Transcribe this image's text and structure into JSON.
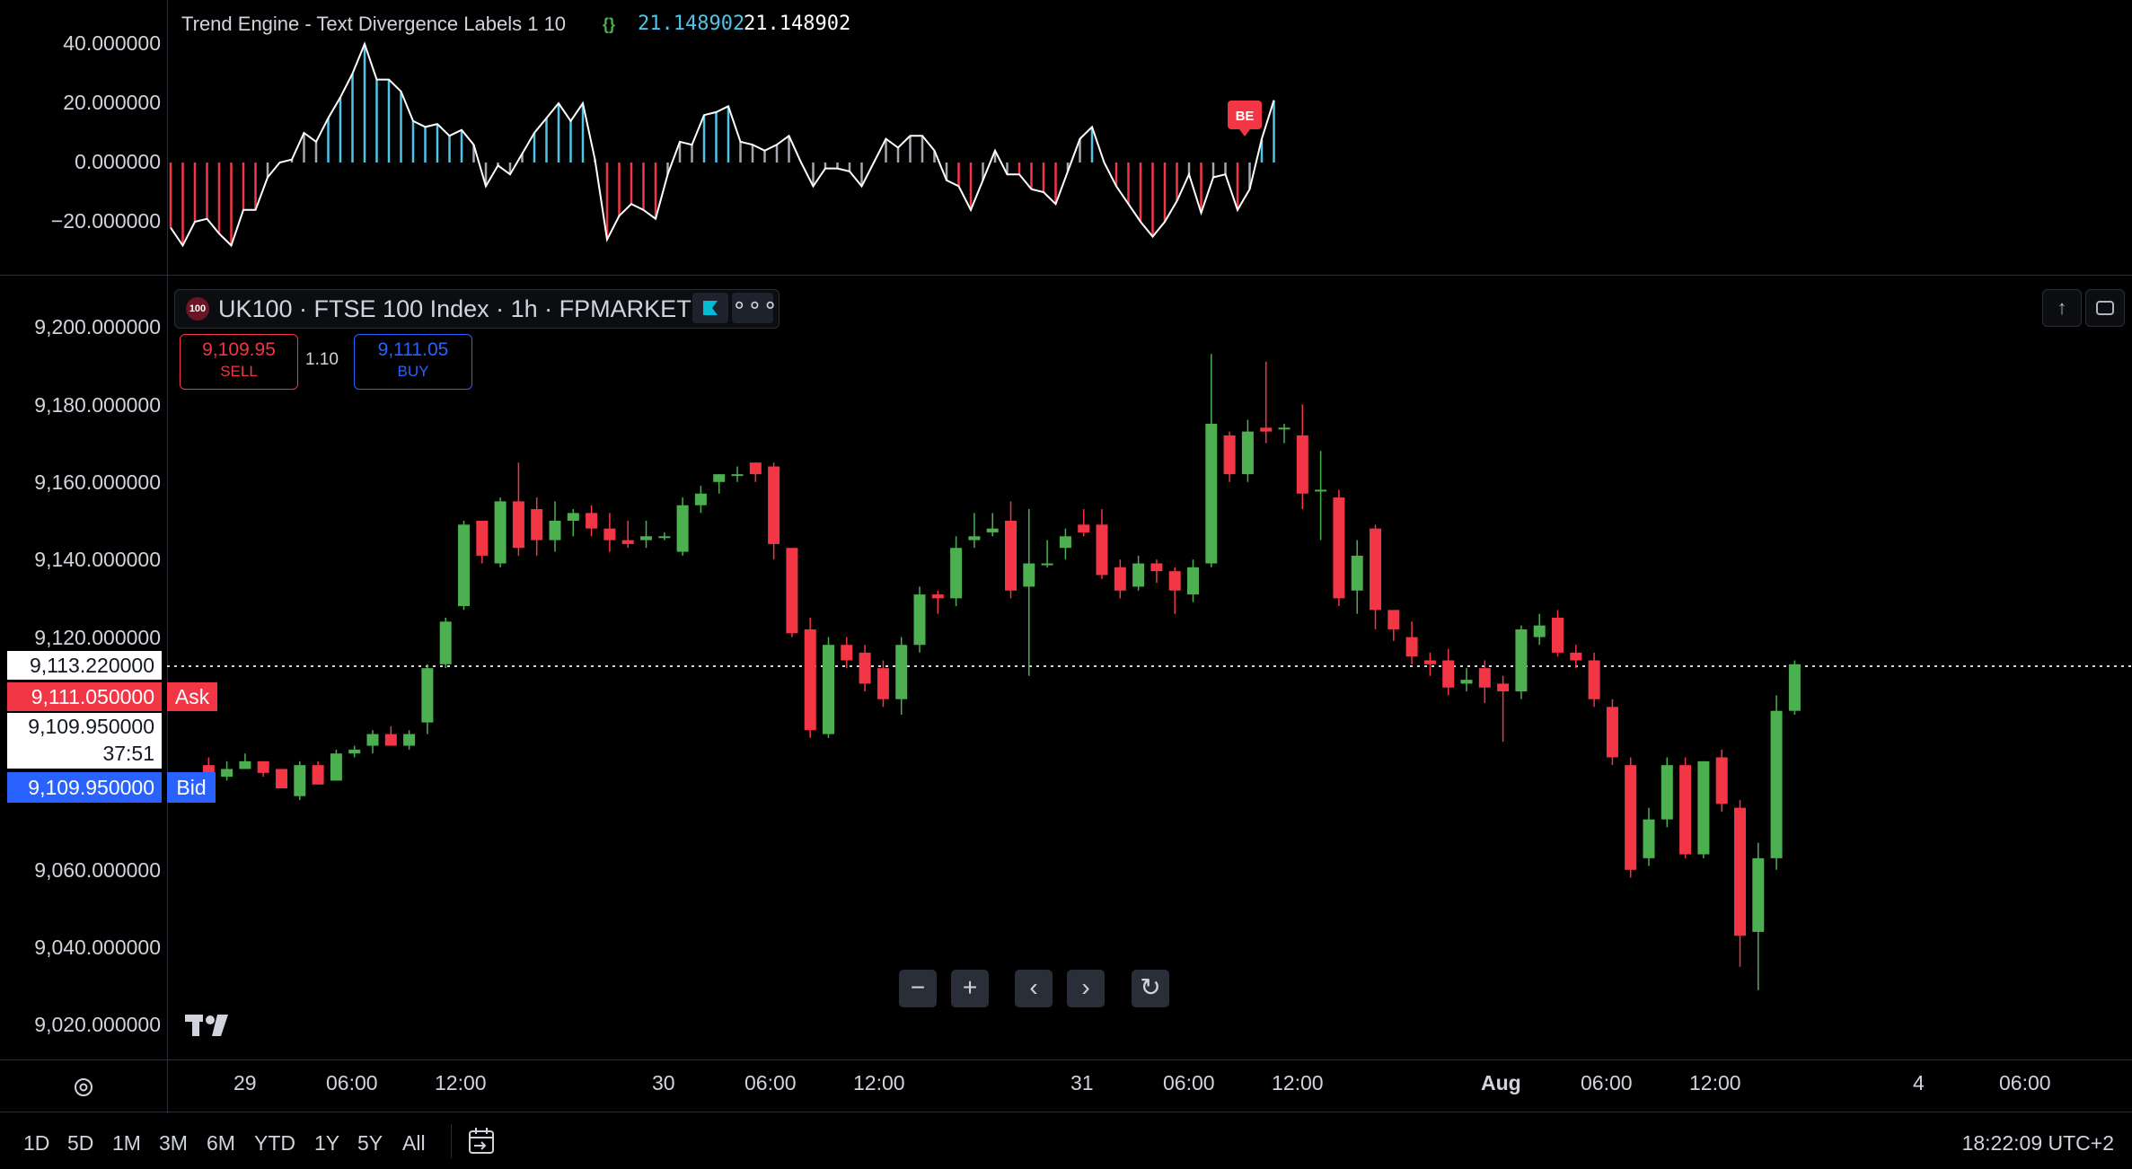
{
  "indicator": {
    "title": "Trend Engine - Text Divergence Labels 1 10",
    "braces_icon": "{}",
    "value_cyan": "21.148902",
    "value_white": "21.148902",
    "divergence_label": "BE",
    "scale": [
      "40.000000",
      "20.000000",
      "0.000000",
      "−20.000000"
    ]
  },
  "symbol": {
    "badge": "100",
    "title": "UK100 · FTSE 100 Index · 1h · FPMARKETS",
    "more": "∘∘∘"
  },
  "trade": {
    "sell_price": "9,109.95",
    "sell_label": "SELL",
    "spread": "1.10",
    "buy_price": "9,111.05",
    "buy_label": "BUY"
  },
  "price_scale": [
    "9,200.000000",
    "9,180.000000",
    "9,160.000000",
    "9,140.000000",
    "9,120.000000",
    "9,060.000000",
    "9,040.000000",
    "9,020.000000"
  ],
  "price_tags": {
    "last": "9,113.220000",
    "ask": "9,111.050000",
    "ask_label": "Ask",
    "bid_upper": "9,109.950000",
    "countdown": "37:51",
    "bid": "9,109.950000",
    "bid_label": "Bid"
  },
  "nav": {
    "zoom_out": "−",
    "zoom_in": "+",
    "back": "‹",
    "forward": "›",
    "reset": "↻"
  },
  "time_axis": [
    {
      "label": "29",
      "bold": false
    },
    {
      "label": "06:00",
      "bold": false
    },
    {
      "label": "12:00",
      "bold": false
    },
    {
      "label": "30",
      "bold": false
    },
    {
      "label": "06:00",
      "bold": false
    },
    {
      "label": "12:00",
      "bold": false
    },
    {
      "label": "31",
      "bold": false
    },
    {
      "label": "06:00",
      "bold": false
    },
    {
      "label": "12:00",
      "bold": false
    },
    {
      "label": "Aug",
      "bold": true
    },
    {
      "label": "06:00",
      "bold": false
    },
    {
      "label": "12:00",
      "bold": false
    },
    {
      "label": "4",
      "bold": false
    },
    {
      "label": "06:00",
      "bold": false
    }
  ],
  "ranges": [
    "1D",
    "5D",
    "1M",
    "3M",
    "6M",
    "YTD",
    "1Y",
    "5Y",
    "All"
  ],
  "clock": "18:22:09 UTC+2",
  "colors": {
    "up": "#4caf50",
    "down": "#f23645",
    "cyan": "#4fc3e8",
    "bg": "#000000"
  },
  "chart_data": [
    {
      "type": "bar",
      "ylim": [
        -30,
        45
      ],
      "histogram": [
        {
          "v": -22,
          "c": "r"
        },
        {
          "v": -28,
          "c": "r"
        },
        {
          "v": -20,
          "c": "r"
        },
        {
          "v": -19,
          "c": "r"
        },
        {
          "v": -24,
          "c": "r"
        },
        {
          "v": -28,
          "c": "r"
        },
        {
          "v": -16,
          "c": "r"
        },
        {
          "v": -16,
          "c": "r"
        },
        {
          "v": -5,
          "c": "g"
        },
        {
          "v": 0,
          "c": "g"
        },
        {
          "v": 1,
          "c": "g"
        },
        {
          "v": 10,
          "c": "g"
        },
        {
          "v": 7,
          "c": "g"
        },
        {
          "v": 15,
          "c": "b"
        },
        {
          "v": 22,
          "c": "b"
        },
        {
          "v": 30,
          "c": "b"
        },
        {
          "v": 40,
          "c": "b"
        },
        {
          "v": 28,
          "c": "b"
        },
        {
          "v": 28,
          "c": "b"
        },
        {
          "v": 24,
          "c": "b"
        },
        {
          "v": 14,
          "c": "b"
        },
        {
          "v": 12,
          "c": "b"
        },
        {
          "v": 13,
          "c": "b"
        },
        {
          "v": 9,
          "c": "b"
        },
        {
          "v": 11,
          "c": "b"
        },
        {
          "v": 6,
          "c": "g"
        },
        {
          "v": -8,
          "c": "g"
        },
        {
          "v": -1,
          "c": "g"
        },
        {
          "v": -4,
          "c": "g"
        },
        {
          "v": 3,
          "c": "g"
        },
        {
          "v": 10,
          "c": "b"
        },
        {
          "v": 15,
          "c": "b"
        },
        {
          "v": 20,
          "c": "b"
        },
        {
          "v": 14,
          "c": "b"
        },
        {
          "v": 20,
          "c": "b"
        },
        {
          "v": 1,
          "c": "g"
        },
        {
          "v": -26,
          "c": "r"
        },
        {
          "v": -18,
          "c": "r"
        },
        {
          "v": -14,
          "c": "r"
        },
        {
          "v": -16,
          "c": "r"
        },
        {
          "v": -19,
          "c": "r"
        },
        {
          "v": -4,
          "c": "g"
        },
        {
          "v": 7,
          "c": "g"
        },
        {
          "v": 6,
          "c": "g"
        },
        {
          "v": 16,
          "c": "b"
        },
        {
          "v": 17,
          "c": "b"
        },
        {
          "v": 19,
          "c": "b"
        },
        {
          "v": 7,
          "c": "g"
        },
        {
          "v": 6,
          "c": "g"
        },
        {
          "v": 4,
          "c": "g"
        },
        {
          "v": 6,
          "c": "g"
        },
        {
          "v": 9,
          "c": "g"
        },
        {
          "v": 0,
          "c": "g"
        },
        {
          "v": -8,
          "c": "g"
        },
        {
          "v": -2,
          "c": "g"
        },
        {
          "v": -2,
          "c": "g"
        },
        {
          "v": -3,
          "c": "g"
        },
        {
          "v": -8,
          "c": "g"
        },
        {
          "v": 0,
          "c": "g"
        },
        {
          "v": 8,
          "c": "g"
        },
        {
          "v": 5,
          "c": "g"
        },
        {
          "v": 9,
          "c": "g"
        },
        {
          "v": 9,
          "c": "g"
        },
        {
          "v": 4,
          "c": "g"
        },
        {
          "v": -6,
          "c": "g"
        },
        {
          "v": -8,
          "c": "r"
        },
        {
          "v": -16,
          "c": "r"
        },
        {
          "v": -6,
          "c": "g"
        },
        {
          "v": 4,
          "c": "g"
        },
        {
          "v": -4,
          "c": "g"
        },
        {
          "v": -4,
          "c": "r"
        },
        {
          "v": -9,
          "c": "r"
        },
        {
          "v": -10,
          "c": "r"
        },
        {
          "v": -14,
          "c": "r"
        },
        {
          "v": -3,
          "c": "g"
        },
        {
          "v": 8,
          "c": "g"
        },
        {
          "v": 12,
          "c": "b"
        },
        {
          "v": 0,
          "c": "g"
        },
        {
          "v": -8,
          "c": "r"
        },
        {
          "v": -14,
          "c": "r"
        },
        {
          "v": -20,
          "c": "r"
        },
        {
          "v": -25,
          "c": "r"
        },
        {
          "v": -20,
          "c": "r"
        },
        {
          "v": -13,
          "c": "r"
        },
        {
          "v": -4,
          "c": "g"
        },
        {
          "v": -17,
          "c": "r"
        },
        {
          "v": -5,
          "c": "g"
        },
        {
          "v": -4,
          "c": "g"
        },
        {
          "v": -16,
          "c": "r"
        },
        {
          "v": -9,
          "c": "g"
        },
        {
          "v": 8,
          "c": "b"
        },
        {
          "v": 21,
          "c": "b"
        }
      ]
    },
    {
      "type": "candlestick",
      "ylim": [
        9015,
        9210
      ],
      "candles": [
        [
          9082,
          9080,
          9085,
          9078
        ],
        [
          9087,
          9084,
          9089,
          9083
        ],
        [
          9084,
          9086,
          9088,
          9083
        ],
        [
          9086,
          9088,
          9090,
          9086
        ],
        [
          9088,
          9085,
          9088,
          9084
        ],
        [
          9086,
          9081,
          9086,
          9081
        ],
        [
          9079,
          9087,
          9088,
          9078
        ],
        [
          9087,
          9082,
          9088,
          9082
        ],
        [
          9083,
          9090,
          9091,
          9083
        ],
        [
          9090,
          9091,
          9092,
          9089
        ],
        [
          9092,
          9095,
          9096,
          9090
        ],
        [
          9095,
          9092,
          9097,
          9092
        ],
        [
          9092,
          9095,
          9096,
          9091
        ],
        [
          9098,
          9112,
          9113,
          9095
        ],
        [
          9113,
          9124,
          9125,
          9112
        ],
        [
          9128,
          9149,
          9150,
          9127
        ],
        [
          9150,
          9141,
          9150,
          9139
        ],
        [
          9139,
          9155,
          9156,
          9138
        ],
        [
          9155,
          9143,
          9165,
          9141
        ],
        [
          9153,
          9145,
          9156,
          9141
        ],
        [
          9145,
          9150,
          9155,
          9142
        ],
        [
          9150,
          9152,
          9153,
          9146
        ],
        [
          9152,
          9148,
          9154,
          9146
        ],
        [
          9148,
          9145,
          9152,
          9142
        ],
        [
          9145,
          9144,
          9150,
          9143
        ],
        [
          9145,
          9146,
          9150,
          9143
        ],
        [
          9146,
          9146,
          9147,
          9145
        ],
        [
          9142,
          9154,
          9156,
          9141
        ],
        [
          9154,
          9157,
          9159,
          9152
        ],
        [
          9160,
          9162,
          9162,
          9157
        ],
        [
          9162,
          9162,
          9164,
          9160
        ],
        [
          9165,
          9162,
          9165,
          9160
        ],
        [
          9164,
          9144,
          9165,
          9140
        ],
        [
          9143,
          9121,
          9143,
          9120
        ],
        [
          9122,
          9096,
          9125,
          9094
        ],
        [
          9095,
          9118,
          9120,
          9094
        ],
        [
          9118,
          9114,
          9120,
          9112
        ],
        [
          9116,
          9108,
          9118,
          9106
        ],
        [
          9112,
          9104,
          9114,
          9102
        ],
        [
          9104,
          9118,
          9120,
          9100
        ],
        [
          9118,
          9131,
          9133,
          9116
        ],
        [
          9131,
          9130,
          9132,
          9126
        ],
        [
          9130,
          9143,
          9146,
          9128
        ],
        [
          9145,
          9146,
          9152,
          9143
        ],
        [
          9147,
          9148,
          9152,
          9146
        ],
        [
          9150,
          9132,
          9155,
          9130
        ],
        [
          9133,
          9139,
          9153,
          9110
        ],
        [
          9139,
          9139,
          9145,
          9138
        ],
        [
          9143,
          9146,
          9148,
          9140
        ],
        [
          9149,
          9147,
          9153,
          9146
        ],
        [
          9149,
          9136,
          9153,
          9135
        ],
        [
          9138,
          9132,
          9140,
          9130
        ],
        [
          9133,
          9139,
          9141,
          9132
        ],
        [
          9139,
          9137,
          9140,
          9134
        ],
        [
          9137,
          9132,
          9138,
          9126
        ],
        [
          9131,
          9138,
          9140,
          9129
        ],
        [
          9139,
          9175,
          9193,
          9138
        ],
        [
          9172,
          9162,
          9173,
          9160
        ],
        [
          9162,
          9173,
          9176,
          9160
        ],
        [
          9174,
          9173,
          9191,
          9170
        ],
        [
          9174,
          9174,
          9175,
          9170
        ],
        [
          9172,
          9157,
          9180,
          9153
        ],
        [
          9158,
          9158,
          9168,
          9145
        ],
        [
          9156,
          9130,
          9158,
          9128
        ],
        [
          9132,
          9141,
          9145,
          9126
        ],
        [
          9148,
          9127,
          9149,
          9122
        ],
        [
          9127,
          9122,
          9125,
          9119
        ],
        [
          9120,
          9115,
          9124,
          9113
        ],
        [
          9114,
          9113,
          9116,
          9110
        ],
        [
          9114,
          9107,
          9117,
          9105
        ],
        [
          9108,
          9109,
          9112,
          9106
        ],
        [
          9112,
          9107,
          9114,
          9103
        ],
        [
          9108,
          9106,
          9110,
          9093
        ],
        [
          9106,
          9122,
          9123,
          9104
        ],
        [
          9120,
          9123,
          9126,
          9118
        ],
        [
          9125,
          9116,
          9127,
          9115
        ],
        [
          9116,
          9114,
          9118,
          9112
        ],
        [
          9114,
          9104,
          9116,
          9102
        ],
        [
          9102,
          9089,
          9104,
          9087
        ],
        [
          9087,
          9060,
          9089,
          9058
        ],
        [
          9063,
          9073,
          9076,
          9061
        ],
        [
          9073,
          9087,
          9089,
          9071
        ],
        [
          9087,
          9064,
          9089,
          9063
        ],
        [
          9064,
          9088,
          9088,
          9063
        ],
        [
          9089,
          9077,
          9091,
          9075
        ],
        [
          9076,
          9043,
          9078,
          9035
        ],
        [
          9044,
          9063,
          9067,
          9029
        ],
        [
          9063,
          9101,
          9105,
          9060
        ],
        [
          9101,
          9113,
          9114,
          9100
        ]
      ]
    }
  ]
}
